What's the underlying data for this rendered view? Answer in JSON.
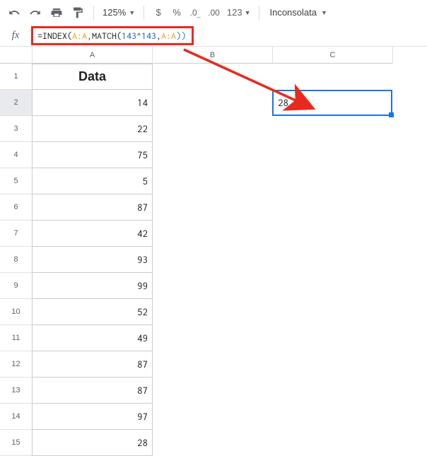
{
  "toolbar": {
    "zoom": "125%",
    "num123": "123",
    "font": "Inconsolata"
  },
  "formula": {
    "eq": "=",
    "fn1": "INDEX",
    "open1": "(",
    "range1": "A:A",
    "comma1": ",",
    "fn2": "MATCH",
    "open2": "(",
    "num1": "143",
    "caret": "^",
    "num2": "143",
    "comma2": ",",
    "range2": "A:A",
    "close2": ")",
    "close1": ")"
  },
  "columns": {
    "A": "A",
    "B": "B",
    "C": "C"
  },
  "header_label": "Data",
  "rows": [
    {
      "n": "1",
      "a": ""
    },
    {
      "n": "2",
      "a": "14"
    },
    {
      "n": "3",
      "a": "22"
    },
    {
      "n": "4",
      "a": "75"
    },
    {
      "n": "5",
      "a": "5"
    },
    {
      "n": "6",
      "a": "87"
    },
    {
      "n": "7",
      "a": "42"
    },
    {
      "n": "8",
      "a": "93"
    },
    {
      "n": "9",
      "a": "99"
    },
    {
      "n": "10",
      "a": "52"
    },
    {
      "n": "11",
      "a": "49"
    },
    {
      "n": "12",
      "a": "87"
    },
    {
      "n": "13",
      "a": "87"
    },
    {
      "n": "14",
      "a": "97"
    },
    {
      "n": "15",
      "a": "28"
    }
  ],
  "selection": {
    "value": "28"
  }
}
